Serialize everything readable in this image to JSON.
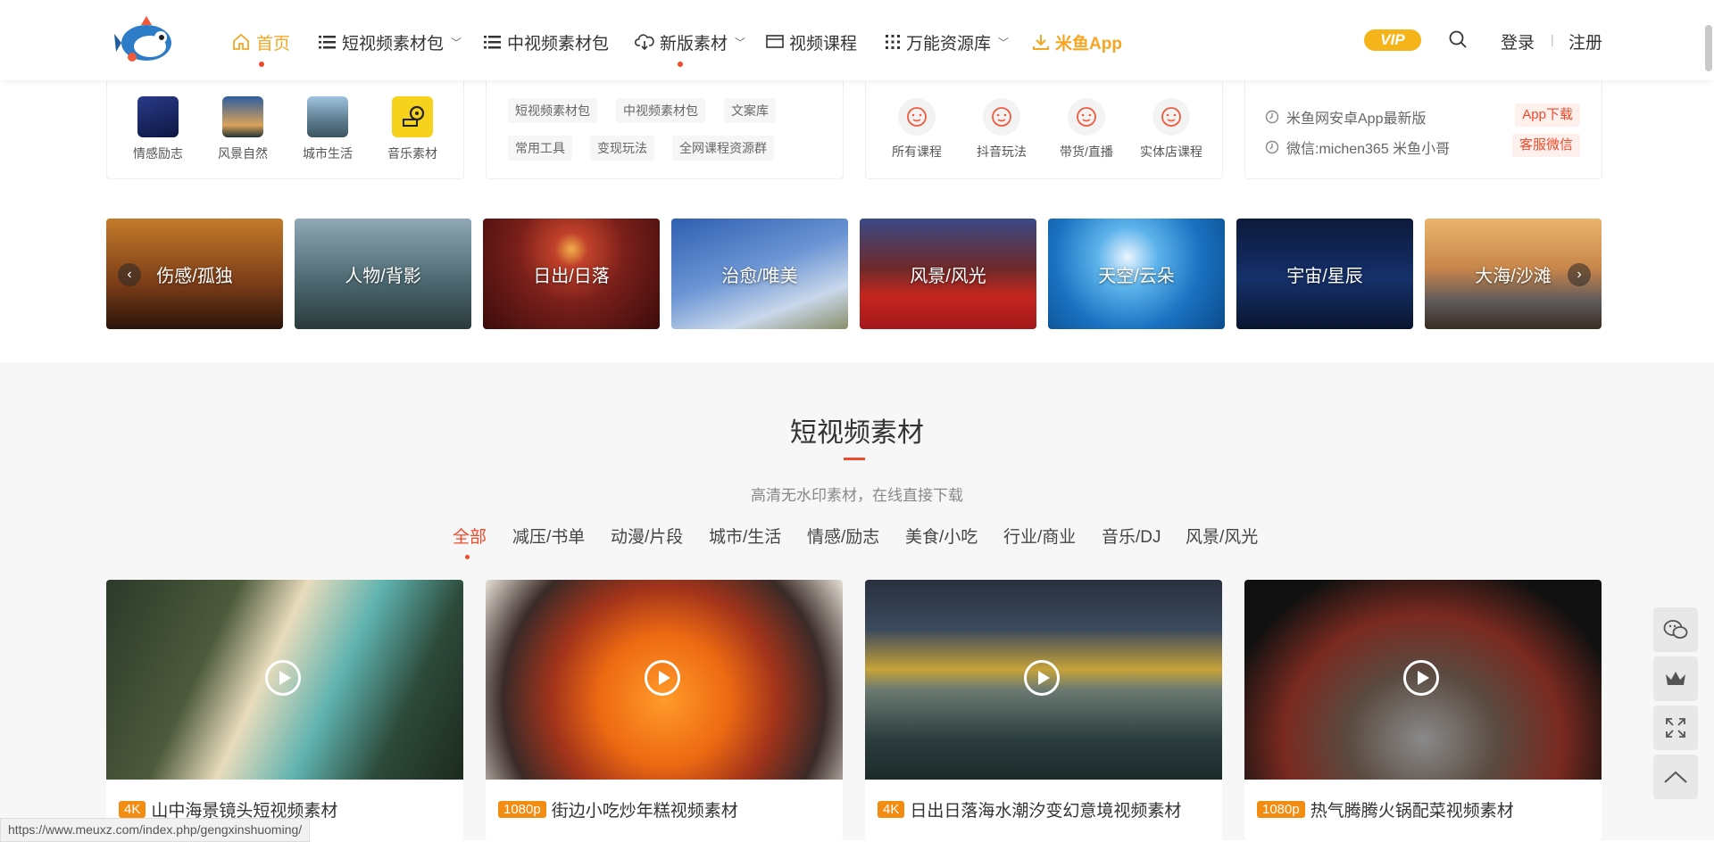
{
  "nav": {
    "items": [
      {
        "label": "首页",
        "icon": "home-icon",
        "active": true
      },
      {
        "label": "短视频素材包",
        "icon": "list-icon",
        "chevron": true
      },
      {
        "label": "中视频素材包",
        "icon": "list-icon"
      },
      {
        "label": "新版素材",
        "icon": "cloud-icon",
        "chevron": true
      },
      {
        "label": "视频课程",
        "icon": "monitor-icon"
      },
      {
        "label": "万能资源库",
        "icon": "grid-icon",
        "chevron": true
      },
      {
        "label": "米鱼App",
        "icon": "download-icon"
      }
    ],
    "vip": "VIP",
    "login": "登录",
    "register": "注册",
    "separator": "|"
  },
  "categories": {
    "icons": [
      "情感励志",
      "风景自然",
      "城市生活",
      "音乐素材"
    ],
    "tags": [
      "短视频素材包",
      "中视频素材包",
      "文案库",
      "常用工具",
      "变现玩法",
      "全网课程资源群"
    ],
    "courses": [
      "所有课程",
      "抖音玩法",
      "带货/直播",
      "实体店课程"
    ],
    "info": [
      {
        "text": "米鱼网安卓App最新版",
        "button": "App下载"
      },
      {
        "text": "微信:michen365 米鱼小哥",
        "button": "客服微信"
      }
    ]
  },
  "carousel": [
    "伤感/孤独",
    "人物/背影",
    "日出/日落",
    "治愈/唯美",
    "风景/风光",
    "天空/云朵",
    "宇宙/星辰",
    "大海/沙滩"
  ],
  "section": {
    "title": "短视频素材",
    "subtitle": "高清无水印素材，在线直接下载",
    "filters": [
      "全部",
      "减压/书单",
      "动漫/片段",
      "城市/生活",
      "情感/励志",
      "美食/小吃",
      "行业/商业",
      "音乐/DJ",
      "风景/风光"
    ]
  },
  "cards": [
    {
      "badge": "4K",
      "title": "山中海景镜头短视频素材"
    },
    {
      "badge": "1080p",
      "title": "街边小吃炒年糕视频素材"
    },
    {
      "badge": "4K",
      "title": "日出日落海水潮汐变幻意境视频素材"
    },
    {
      "badge": "1080p",
      "title": "热气腾腾火锅配菜视频素材"
    }
  ],
  "status_url": "https://www.meuxz.com/index.php/gengxinshuoming/",
  "colors": {
    "accent": "#f5a623",
    "red": "#f04a2a",
    "badge": "#f28c12"
  }
}
